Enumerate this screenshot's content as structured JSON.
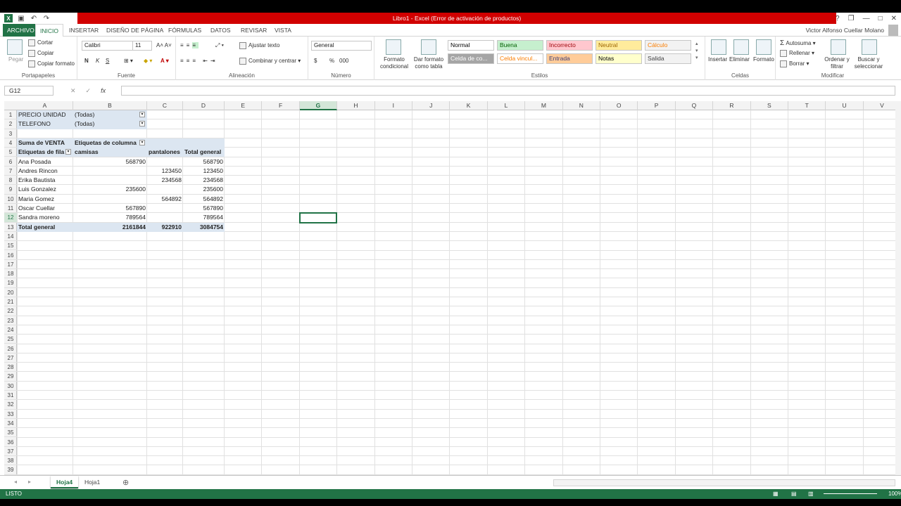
{
  "window": {
    "title": "Libro1 - Excel (Error de activación de productos)"
  },
  "qat": {
    "undo": "↶",
    "redo": "↷"
  },
  "win_controls": {
    "help": "?",
    "restore": "❐",
    "minimize": "—",
    "maximize": "□",
    "close": "✕"
  },
  "ribbon_tabs": [
    {
      "label": "ARCHIVO"
    },
    {
      "label": "INICIO"
    },
    {
      "label": "INSERTAR"
    },
    {
      "label": "DISEÑO DE PÁGINA"
    },
    {
      "label": "FÓRMULAS"
    },
    {
      "label": "DATOS"
    },
    {
      "label": "REVISAR"
    },
    {
      "label": "VISTA"
    }
  ],
  "user": {
    "name": "Victor Alfonso Cuellar Molano"
  },
  "clipboard": {
    "paste": "Pegar",
    "cut": "Cortar",
    "copy": "Copiar",
    "format_painter": "Copiar formato",
    "label": "Portapapeles"
  },
  "font": {
    "name": "Calibri",
    "size": "11",
    "bold": "N",
    "italic": "K",
    "underline": "S",
    "label": "Fuente"
  },
  "alignment": {
    "wrap": "Ajustar texto",
    "merge": "Combinar y centrar",
    "label": "Alineación"
  },
  "number": {
    "format": "General",
    "currency": "$",
    "percent": "%",
    "thousands": "000",
    "label": "Número"
  },
  "styles": {
    "cond_format": "Formato condicional",
    "table_format": "Dar formato como tabla",
    "label": "Estilos",
    "items": [
      {
        "label": "Normal",
        "bg": "#ffffff",
        "fg": "#000000"
      },
      {
        "label": "Buena",
        "bg": "#c6efce",
        "fg": "#006100"
      },
      {
        "label": "Incorrecto",
        "bg": "#ffc7ce",
        "fg": "#9c0006"
      },
      {
        "label": "Neutral",
        "bg": "#ffeb9c",
        "fg": "#9c6500"
      },
      {
        "label": "Cálculo",
        "bg": "#f2f2f2",
        "fg": "#fa7d00"
      },
      {
        "label": "Celda de co...",
        "bg": "#a5a5a5",
        "fg": "#ffffff"
      },
      {
        "label": "Celda vincul...",
        "bg": "#ffffff",
        "fg": "#fa7d00"
      },
      {
        "label": "Entrada",
        "bg": "#ffcc99",
        "fg": "#3f3f76"
      },
      {
        "label": "Notas",
        "bg": "#ffffcc",
        "fg": "#000000"
      },
      {
        "label": "Salida",
        "bg": "#f2f2f2",
        "fg": "#3f3f3f"
      }
    ]
  },
  "cells_group": {
    "insert": "Insertar",
    "delete": "Eliminar",
    "format": "Formato",
    "label": "Celdas"
  },
  "modify": {
    "autosum": "Autosuma",
    "fill": "Rellenar",
    "clear": "Borrar",
    "sort": "Ordenar y filtrar",
    "find": "Buscar y seleccionar",
    "label": "Modificar"
  },
  "formula_bar": {
    "name_box": "G12",
    "cancel": "✕",
    "enter": "✓",
    "fx": "fx",
    "value": ""
  },
  "columns": [
    "A",
    "B",
    "C",
    "D",
    "E",
    "F",
    "G",
    "H",
    "I",
    "J",
    "K",
    "L",
    "M",
    "N",
    "O",
    "P",
    "Q",
    "R",
    "S",
    "T",
    "U",
    "V"
  ],
  "selected_column": "G",
  "rows": [
    "1",
    "2",
    "3",
    "4",
    "5",
    "6",
    "7",
    "8",
    "9",
    "10",
    "11",
    "12",
    "13",
    "14",
    "15",
    "16",
    "17",
    "18",
    "19",
    "20",
    "21",
    "22",
    "23",
    "24",
    "25",
    "26",
    "27",
    "28",
    "29",
    "30",
    "31",
    "32",
    "33",
    "34",
    "35",
    "36",
    "37",
    "38",
    "39"
  ],
  "selected_row": "12",
  "pivot": {
    "filters": [
      {
        "field": "PRECIO UNIDAD",
        "value": "(Todas)"
      },
      {
        "field": "TELEFONO",
        "value": "(Todas)"
      }
    ],
    "value_label": "Suma de VENTA",
    "col_label": "Etiquetas de columna",
    "row_label": "Etiquetas de fila",
    "col_headers": [
      "camisas",
      "pantalones",
      "Total general"
    ],
    "data": [
      {
        "name": "Ana Posada",
        "camisas": "568790",
        "pantalones": "",
        "total": "568790"
      },
      {
        "name": "Andres Rincon",
        "camisas": "",
        "pantalones": "123450",
        "total": "123450"
      },
      {
        "name": "Erika Bautista",
        "camisas": "",
        "pantalones": "234568",
        "total": "234568"
      },
      {
        "name": "Luis Gonzalez",
        "camisas": "235600",
        "pantalones": "",
        "total": "235600"
      },
      {
        "name": "Maria Gomez",
        "camisas": "",
        "pantalones": "564892",
        "total": "564892"
      },
      {
        "name": "Oscar Cuellar",
        "camisas": "567890",
        "pantalones": "",
        "total": "567890"
      },
      {
        "name": "Sandra moreno",
        "camisas": "789564",
        "pantalones": "",
        "total": "789564"
      }
    ],
    "grand_total": {
      "name": "Total general",
      "camisas": "2161844",
      "pantalones": "922910",
      "total": "3084754"
    }
  },
  "sheets": [
    {
      "label": "Hoja4",
      "active": true
    },
    {
      "label": "Hoja1",
      "active": false
    }
  ],
  "status": {
    "mode": "LISTO",
    "zoom": "100%"
  }
}
